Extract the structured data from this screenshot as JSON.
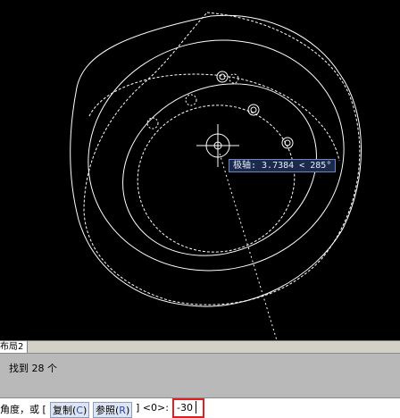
{
  "tooltip": {
    "text": "极轴: 3.7384 < 285°"
  },
  "tabs": [
    {
      "label": "布局2"
    }
  ],
  "history": {
    "line": "找到 28 个"
  },
  "command": {
    "prompt_prefix": "角度，或 [",
    "opt_copy": "复制(",
    "opt_copy_key": "C",
    "opt_copy_end": ")",
    "opt_ref": "参照(",
    "opt_ref_key": "R",
    "opt_ref_end": ")",
    "prompt_suffix": "] <0>:",
    "value": "-30"
  },
  "colors": {
    "canvas": "#000000",
    "highlight": "#e02020",
    "arrow": "#e02020",
    "drawing": "#ffffff"
  }
}
